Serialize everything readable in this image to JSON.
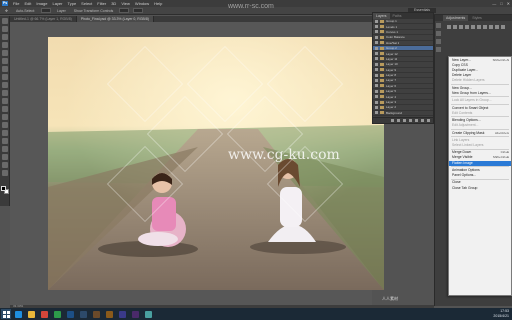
{
  "menubar": {
    "app_badge": "Ps",
    "items": [
      "File",
      "Edit",
      "Image",
      "Layer",
      "Type",
      "Select",
      "Filter",
      "3D",
      "View",
      "Window",
      "Help"
    ],
    "window_controls": [
      "—",
      "□",
      "✕"
    ]
  },
  "options_bar": {
    "items": [
      "Auto-Select:",
      "Layer",
      "Show Transform Controls"
    ],
    "workspace": "Essentials"
  },
  "tabs": [
    {
      "label": "Untitled-1 @ 66.7% (Layer 1, RGB/8)",
      "active": false
    },
    {
      "label": "Photo_Final.psd @ 33.3% (Layer 0, RGB/8)",
      "active": true
    }
  ],
  "layers_panel": {
    "tabs": [
      "Layers",
      "Paths"
    ],
    "rows": [
      "Group 1",
      "Levels 1",
      "Curves 1",
      "Color Balance",
      "Hue/Sat 1",
      "Group 2",
      "Layer 12",
      "Layer 11",
      "Layer 10",
      "Layer 9",
      "Layer 8",
      "Layer 7",
      "Layer 6",
      "Layer 5",
      "Layer 4",
      "Layer 3",
      "Layer 2",
      "Background"
    ],
    "selected_index": 5
  },
  "right_dock": {
    "tabs": [
      "Adjustments",
      "Styles"
    ]
  },
  "context_menu": {
    "items": [
      {
        "label": "New Layer...",
        "shortcut": "Shift+Ctrl+N",
        "state": "normal"
      },
      {
        "label": "Copy CSS",
        "shortcut": "",
        "state": "normal"
      },
      {
        "label": "Duplicate Layer...",
        "shortcut": "",
        "state": "normal"
      },
      {
        "label": "Delete Layer",
        "shortcut": "",
        "state": "normal"
      },
      {
        "label": "Delete Hidden Layers",
        "shortcut": "",
        "state": "disabled"
      },
      {
        "sep": true
      },
      {
        "label": "New Group...",
        "shortcut": "",
        "state": "normal"
      },
      {
        "label": "New Group from Layers...",
        "shortcut": "",
        "state": "normal"
      },
      {
        "sep": true
      },
      {
        "label": "Lock All Layers in Group...",
        "shortcut": "",
        "state": "disabled"
      },
      {
        "sep": true
      },
      {
        "label": "Convert to Smart Object",
        "shortcut": "",
        "state": "normal"
      },
      {
        "label": "Edit Contents",
        "shortcut": "",
        "state": "disabled"
      },
      {
        "sep": true
      },
      {
        "label": "Blending Options...",
        "shortcut": "",
        "state": "normal"
      },
      {
        "label": "Edit Adjustment...",
        "shortcut": "",
        "state": "disabled"
      },
      {
        "sep": true
      },
      {
        "label": "Create Clipping Mask",
        "shortcut": "Alt+Ctrl+G",
        "state": "normal"
      },
      {
        "sep": true
      },
      {
        "label": "Link Layers",
        "shortcut": "",
        "state": "disabled"
      },
      {
        "label": "Select Linked Layers",
        "shortcut": "",
        "state": "disabled"
      },
      {
        "sep": true
      },
      {
        "label": "Merge Down",
        "shortcut": "Ctrl+E",
        "state": "normal"
      },
      {
        "label": "Merge Visible",
        "shortcut": "Shift+Ctrl+E",
        "state": "normal"
      },
      {
        "label": "Flatten Image",
        "shortcut": "",
        "state": "highlight"
      },
      {
        "sep": true
      },
      {
        "label": "Animation Options",
        "shortcut": "",
        "state": "normal"
      },
      {
        "label": "Panel Options...",
        "shortcut": "",
        "state": "normal"
      },
      {
        "sep": true
      },
      {
        "label": "Close",
        "shortcut": "",
        "state": "normal"
      },
      {
        "label": "Close Tab Group",
        "shortcut": "",
        "state": "normal"
      }
    ]
  },
  "status": {
    "text": "33.33%"
  },
  "taskbar": {
    "apps": [
      {
        "icon": "ie-icon",
        "color": "#1f8fe0"
      },
      {
        "icon": "explorer-icon",
        "color": "#e8b73a"
      },
      {
        "icon": "chrome-icon",
        "color": "#d4463a"
      },
      {
        "icon": "store-icon",
        "color": "#2d9b4a"
      },
      {
        "icon": "photoshop-icon",
        "color": "#1c4f86"
      },
      {
        "icon": "lightroom-icon",
        "color": "#2d4a6a"
      },
      {
        "icon": "bridge-icon",
        "color": "#6b4a2a"
      },
      {
        "icon": "illustrator-icon",
        "color": "#8a5a1a"
      },
      {
        "icon": "aftereffects-icon",
        "color": "#3a3a8a"
      },
      {
        "icon": "premiere-icon",
        "color": "#4a2a6a"
      },
      {
        "icon": "media-icon",
        "color": "#4aa0a0"
      }
    ],
    "time": "17:53",
    "date": "2015/4/21"
  },
  "watermarks": {
    "site": "www.rr-sc.com",
    "center": "www.cg-ku.com",
    "corner": "人人素材"
  },
  "colors": {
    "selection_blue": "#2a7ad6",
    "ps_blue": "#2a78c8"
  }
}
